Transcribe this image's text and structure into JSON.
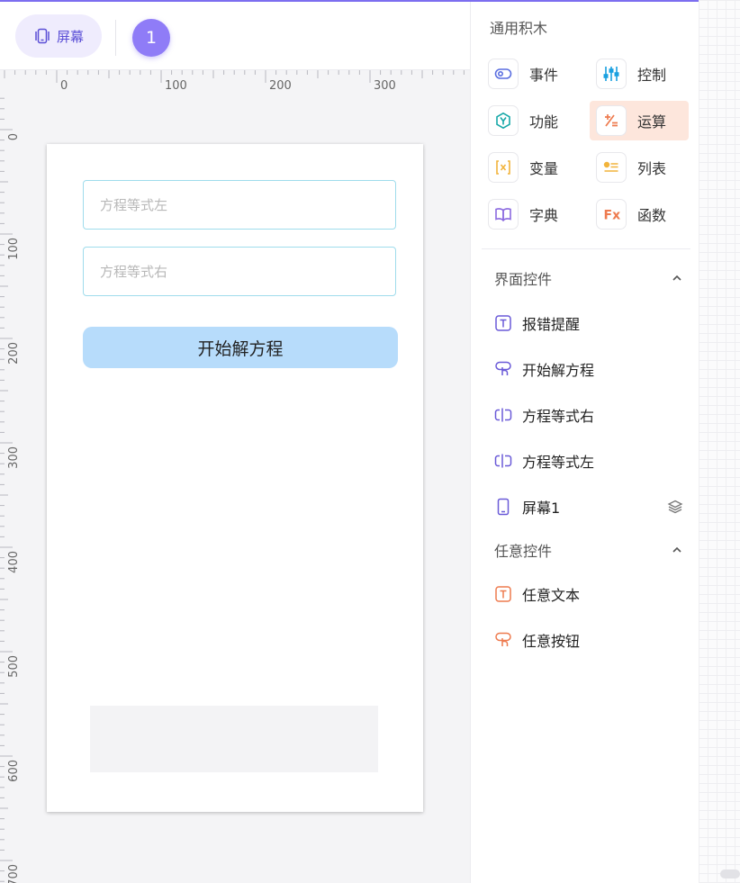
{
  "toolbar": {
    "screen_label": "屏幕",
    "screen_number": "1"
  },
  "ruler": {
    "h_labels": [
      "0",
      "100",
      "200",
      "300"
    ],
    "v_labels": [
      "0",
      "100",
      "200",
      "300",
      "400",
      "500",
      "600",
      "700"
    ]
  },
  "phone": {
    "eq_left_placeholder": "方程等式左",
    "eq_right_placeholder": "方程等式右",
    "solve_label": "开始解方程"
  },
  "panel": {
    "blocks_title": "通用积木",
    "blocks": [
      {
        "label": "事件",
        "icon": "event-icon"
      },
      {
        "label": "控制",
        "icon": "control-icon"
      },
      {
        "label": "功能",
        "icon": "function-icon"
      },
      {
        "label": "运算",
        "icon": "operation-icon"
      },
      {
        "label": "变量",
        "icon": "variable-icon"
      },
      {
        "label": "列表",
        "icon": "list-icon"
      },
      {
        "label": "字典",
        "icon": "dictionary-icon"
      },
      {
        "label": "函数",
        "icon": "fx-icon"
      }
    ],
    "ui_group_title": "界面控件",
    "ui_components": [
      {
        "label": "报错提醒",
        "icon": "text-icon"
      },
      {
        "label": "开始解方程",
        "icon": "button-icon"
      },
      {
        "label": "方程等式右",
        "icon": "input-icon"
      },
      {
        "label": "方程等式左",
        "icon": "input-icon"
      },
      {
        "label": "屏幕1",
        "icon": "phone-icon"
      }
    ],
    "any_group_title": "任意控件",
    "any_components": [
      {
        "label": "任意文本",
        "icon": "text-icon"
      },
      {
        "label": "任意按钮",
        "icon": "button-icon"
      }
    ]
  },
  "colors": {
    "accent": "#7c6ef0",
    "badge": "#8f7cf7",
    "solve_button": "#b7dcfb",
    "active_block": "#fde6dc",
    "input_border": "#9fdcec"
  }
}
